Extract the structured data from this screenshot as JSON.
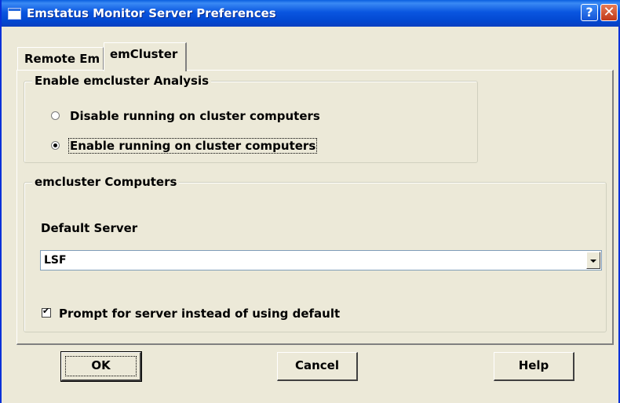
{
  "window": {
    "title": "Emstatus Monitor Server Preferences",
    "help_button": "?",
    "close_button": "✕"
  },
  "tabs": [
    {
      "label": "Remote Em",
      "active": false
    },
    {
      "label": "emCluster",
      "active": true
    }
  ],
  "analysis_group": {
    "title": "Enable emcluster Analysis",
    "options": [
      {
        "label": "Disable running on cluster computers",
        "selected": false
      },
      {
        "label": "Enable running on cluster computers",
        "selected": true
      }
    ]
  },
  "computers_group": {
    "title": "emcluster Computers",
    "default_server_label": "Default Server",
    "default_server_value": "LSF",
    "prompt_checkbox_label": "Prompt for server instead of using default",
    "prompt_checked": true
  },
  "buttons": {
    "ok": "OK",
    "cancel": "Cancel",
    "help": "Help"
  },
  "colors": {
    "titlebar": "#0a56e0",
    "window_bg": "#ece9d8"
  }
}
